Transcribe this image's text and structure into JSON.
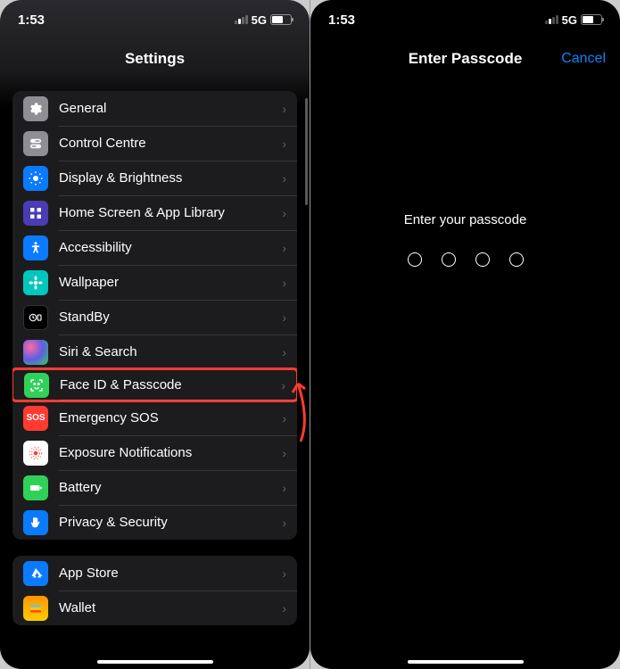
{
  "status": {
    "time": "1:53",
    "network": "5G"
  },
  "left": {
    "title": "Settings",
    "group1": [
      {
        "icon": "general",
        "label": "General"
      },
      {
        "icon": "control",
        "label": "Control Centre"
      },
      {
        "icon": "display",
        "label": "Display & Brightness"
      },
      {
        "icon": "home",
        "label": "Home Screen & App Library"
      },
      {
        "icon": "access",
        "label": "Accessibility"
      },
      {
        "icon": "wallpaper",
        "label": "Wallpaper"
      },
      {
        "icon": "standby",
        "label": "StandBy"
      },
      {
        "icon": "siri",
        "label": "Siri & Search"
      },
      {
        "icon": "faceid",
        "label": "Face ID & Passcode",
        "highlighted": true
      },
      {
        "icon": "sos",
        "label": "Emergency SOS"
      },
      {
        "icon": "exposure",
        "label": "Exposure Notifications"
      },
      {
        "icon": "battery",
        "label": "Battery"
      },
      {
        "icon": "privacy",
        "label": "Privacy & Security"
      }
    ],
    "group2": [
      {
        "icon": "appstore",
        "label": "App Store"
      },
      {
        "icon": "wallet",
        "label": "Wallet"
      }
    ]
  },
  "right": {
    "title": "Enter Passcode",
    "cancel": "Cancel",
    "prompt": "Enter your passcode",
    "digit_count": 4
  }
}
